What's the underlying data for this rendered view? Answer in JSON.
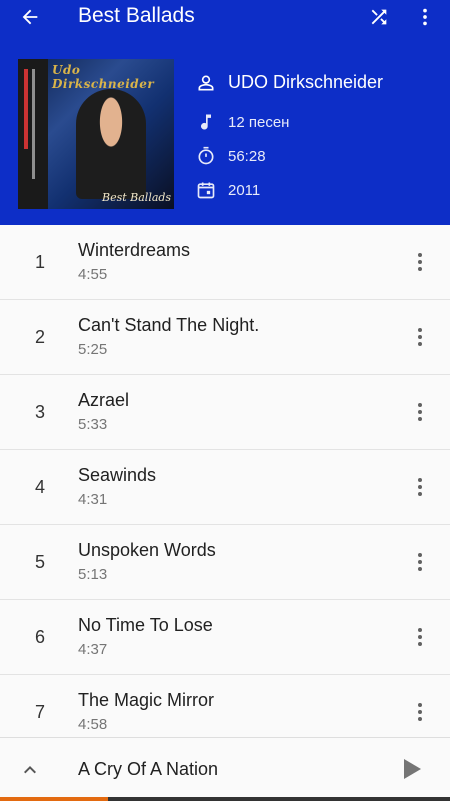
{
  "header": {
    "title": "Best Ballads",
    "cover": {
      "logo_text": "Udo Dirkschneider",
      "subtitle": "Best Ballads"
    },
    "artist": "UDO Dirkschneider",
    "songs_count": "12 песен",
    "duration": "56:28",
    "year": "2011",
    "bg_color": "#0d2ec7"
  },
  "tracks": [
    {
      "num": "1",
      "title": "Winterdreams",
      "duration": "4:55"
    },
    {
      "num": "2",
      "title": "Can't Stand The Night.",
      "duration": "5:25"
    },
    {
      "num": "3",
      "title": "Azrael",
      "duration": "5:33"
    },
    {
      "num": "4",
      "title": "Seawinds",
      "duration": "4:31"
    },
    {
      "num": "5",
      "title": "Unspoken Words",
      "duration": "5:13"
    },
    {
      "num": "6",
      "title": "No Time To Lose",
      "duration": "4:37"
    },
    {
      "num": "7",
      "title": "The Magic Mirror",
      "duration": "4:58"
    }
  ],
  "player": {
    "now_playing": "A Cry Of A Nation",
    "progress_fraction": 0.24,
    "progress_color": "#e36a10"
  },
  "icons": {
    "back": "arrow-left",
    "shuffle": "shuffle",
    "more": "more-vert",
    "artist": "person",
    "songs": "music-note",
    "duration": "timer",
    "year": "calendar",
    "expand": "chevron-up",
    "play": "play"
  }
}
